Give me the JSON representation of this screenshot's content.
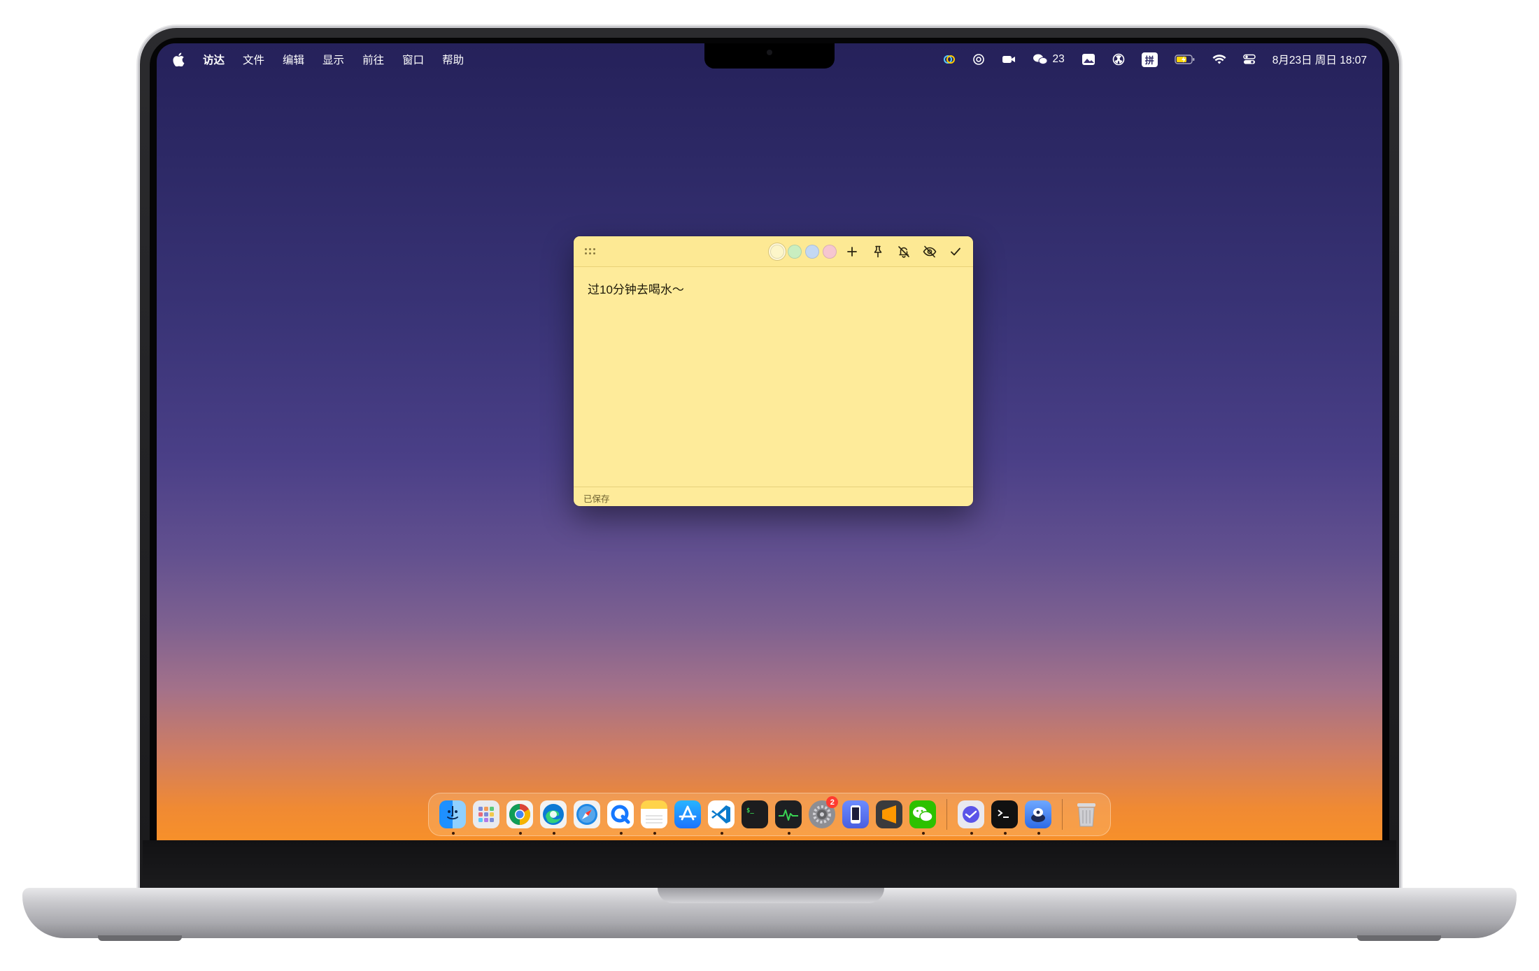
{
  "menubar": {
    "items": [
      "访达",
      "文件",
      "编辑",
      "显示",
      "前往",
      "窗口",
      "帮助"
    ],
    "wechat_count": "23",
    "input_method": "拼",
    "datetime": "8月23日 周日 18:07"
  },
  "note": {
    "text": "过10分钟去喝水～",
    "status": "已保存",
    "colors": [
      "#fdf6c9",
      "#c9eec0",
      "#c3d8f3",
      "#f6c6d0"
    ],
    "selected_color": 0
  },
  "dock": {
    "apps": [
      {
        "name": "finder",
        "running": true
      },
      {
        "name": "launchpad",
        "running": false
      },
      {
        "name": "chrome",
        "running": true
      },
      {
        "name": "edge",
        "running": true
      },
      {
        "name": "safari",
        "running": false
      },
      {
        "name": "qq-browser",
        "running": true
      },
      {
        "name": "notes",
        "running": true
      },
      {
        "name": "app-store",
        "running": false
      },
      {
        "name": "vscode",
        "running": true
      },
      {
        "name": "terminal",
        "running": false
      },
      {
        "name": "activity-monitor",
        "running": true
      },
      {
        "name": "system-settings",
        "running": false,
        "badge": "2"
      },
      {
        "name": "simulator",
        "running": false
      },
      {
        "name": "sublime-text",
        "running": false
      },
      {
        "name": "wechat",
        "running": true
      },
      {
        "name": "xcode-tool",
        "running": true
      },
      {
        "name": "iterm",
        "running": true
      },
      {
        "name": "sticky-app",
        "running": true
      },
      {
        "name": "trash",
        "running": false
      }
    ]
  }
}
